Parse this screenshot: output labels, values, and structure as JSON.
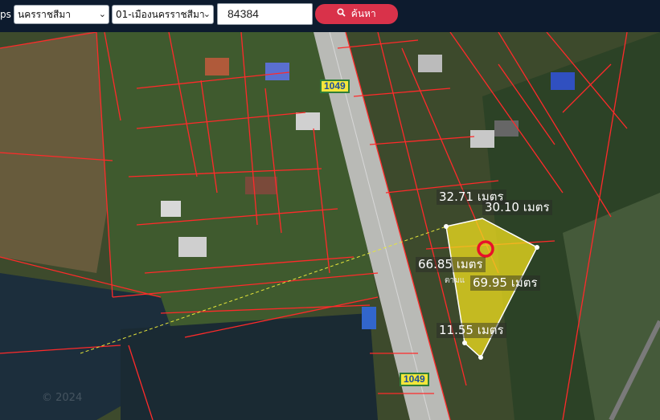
{
  "header": {
    "brand_fragment": "ps",
    "province_select": "นครราชสีมา",
    "district_select": "01-เมืองนครราชสีมา",
    "parcel_input": "84384",
    "search_button": "ค้นหา",
    "search_icon": "search-icon"
  },
  "map": {
    "road_labels": [
      "1049",
      "1049"
    ],
    "measurements": [
      "32.71 เมตร",
      "30.10 เมตร",
      "66.85 เมตร",
      "69.95 เมตร",
      "11.55 เมตร"
    ],
    "small_label": "ตามแ",
    "copyright": "© 2024",
    "colors": {
      "parcel_lines": "#ff2a2a",
      "highlight_fill": "#f1e01e",
      "marker": "#e8102a",
      "dash_line": "#e6e63a"
    }
  }
}
